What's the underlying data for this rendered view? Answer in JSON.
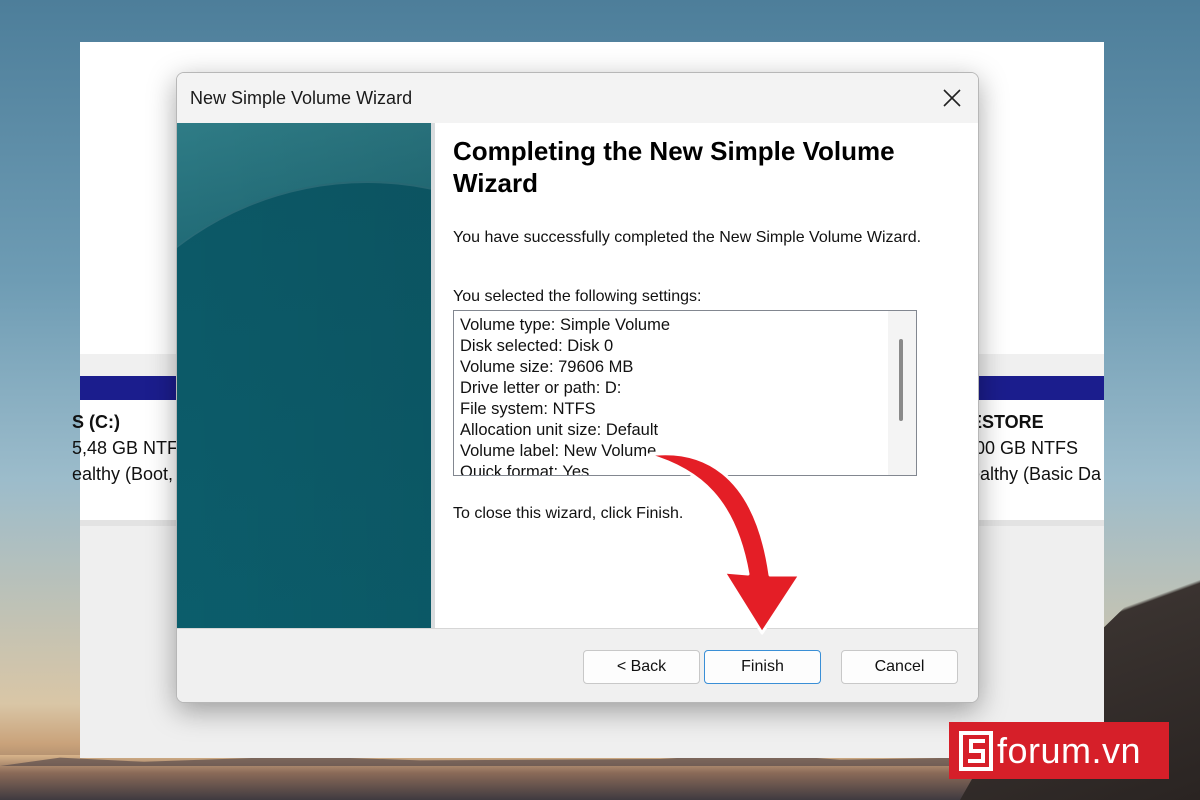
{
  "background_window": {
    "left_partition": {
      "name": "S  (C:)",
      "size": "5,48 GB NTF",
      "status": "ealthy (Boot,"
    },
    "right_partition": {
      "name": "ESTORE",
      "size": ",00 GB NTFS",
      "status": "ealthy (Basic Da"
    }
  },
  "dialog": {
    "title": "New Simple Volume Wizard",
    "heading": "Completing the New Simple Volume Wizard",
    "intro": "You have successfully completed the New Simple Volume Wizard.",
    "settings_label": "You selected the following settings:",
    "settings": [
      "Volume type: Simple Volume",
      "Disk selected: Disk 0",
      "Volume size: 79606 MB",
      "Drive letter or path: D:",
      "File system: NTFS",
      "Allocation unit size: Default",
      "Volume label: New Volume",
      "Quick format: Yes"
    ],
    "close_hint": "To close this wizard, click Finish.",
    "buttons": {
      "back": "< Back",
      "finish": "Finish",
      "cancel": "Cancel"
    }
  },
  "annotation": {
    "arrow_color": "#e41e26",
    "target": "Finish"
  },
  "watermark": {
    "text": "forum.vn",
    "color": "#d61f29"
  }
}
